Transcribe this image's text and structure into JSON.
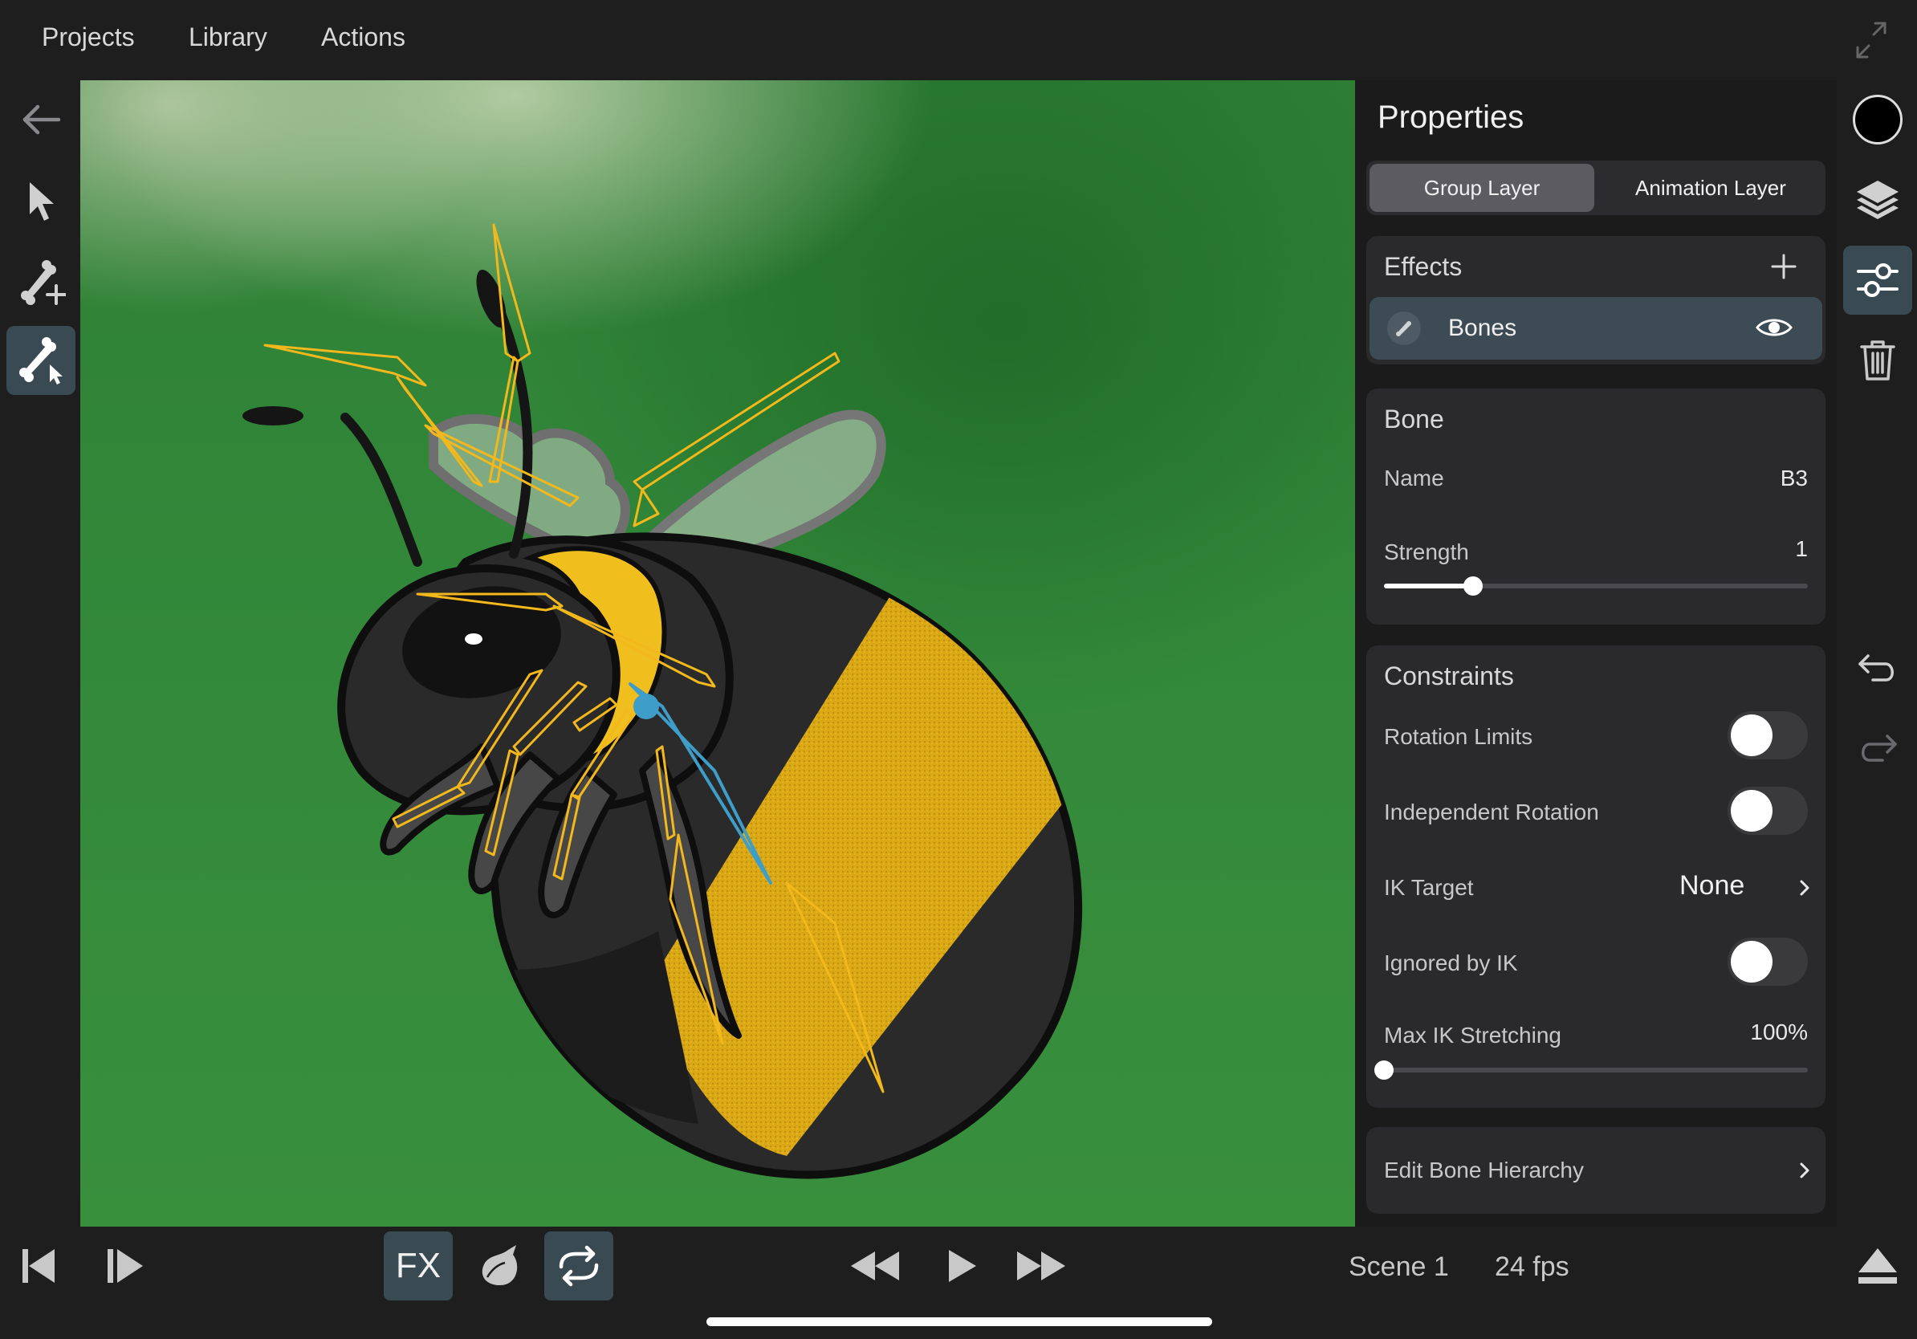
{
  "menu": {
    "projects": "Projects",
    "library": "Library",
    "actions": "Actions"
  },
  "icons": {
    "expand": "expand-icon",
    "back": "back-arrow-icon",
    "select": "pointer-icon",
    "add_bone": "add-bone-icon",
    "bone_select": "bone-select-icon",
    "color": "color-swatch-icon",
    "layers": "layers-icon",
    "adjust": "sliders-icon",
    "delete": "trash-icon",
    "undo": "undo-icon",
    "redo": "redo-icon",
    "eject": "eject-icon"
  },
  "properties": {
    "title": "Properties",
    "tabs": [
      "Group Layer",
      "Animation Layer"
    ],
    "active_tab": "Group Layer",
    "effects": {
      "title": "Effects",
      "items": [
        {
          "label": "Bones",
          "visible": true
        }
      ]
    },
    "bone": {
      "title": "Bone",
      "name_label": "Name",
      "name_value": "B3",
      "strength_label": "Strength",
      "strength_value": "1",
      "strength_fraction": 0.21
    },
    "constraints": {
      "title": "Constraints",
      "rotation_limits": {
        "label": "Rotation Limits",
        "on": false
      },
      "independent_rotation": {
        "label": "Independent Rotation",
        "on": false
      },
      "ik_target": {
        "label": "IK Target",
        "value": "None"
      },
      "ignored_by_ik": {
        "label": "Ignored by IK",
        "on": false
      },
      "max_ik_stretching": {
        "label": "Max IK Stretching",
        "value": "100%",
        "fraction": 0.0
      }
    },
    "edit_hierarchy": "Edit Bone Hierarchy"
  },
  "bottom": {
    "fx": "FX",
    "scene": "Scene 1",
    "fps": "24 fps"
  },
  "colors": {
    "accent_active": "#3a4a52",
    "bone_yellow": "#f2b81c",
    "bone_selected": "#3f9ec9",
    "canvas_green": "#33893a"
  }
}
